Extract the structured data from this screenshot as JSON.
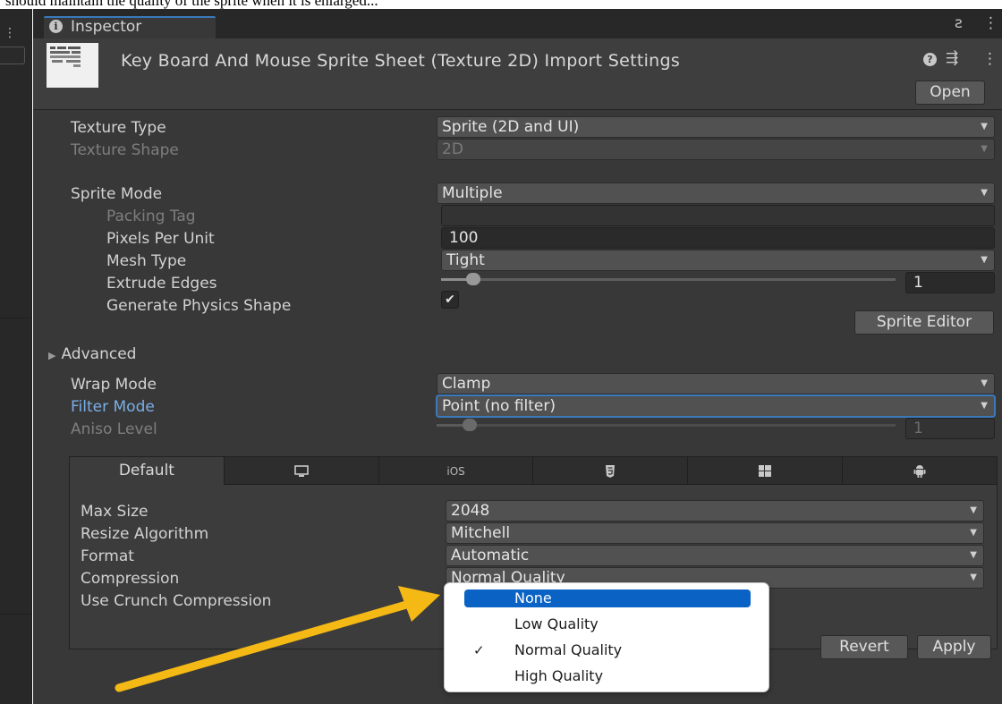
{
  "caption": "should maintain the quality of the sprite when it is enlarged...",
  "window": {
    "tab_label": "Inspector",
    "header_title": "Key Board And Mouse Sprite Sheet (Texture 2D) Import Settings",
    "open_label": "Open"
  },
  "icons": {
    "tab": "info-icon",
    "lock": "lock-icon",
    "menu": "kebab-menu-icon",
    "help": "help-icon",
    "preset": "preset-sliders-icon"
  },
  "fields": {
    "texture_type": {
      "label": "Texture Type",
      "value": "Sprite (2D and UI)"
    },
    "texture_shape": {
      "label": "Texture Shape",
      "value": "2D"
    },
    "sprite_mode": {
      "label": "Sprite Mode",
      "value": "Multiple"
    },
    "packing_tag": {
      "label": "Packing Tag",
      "value": ""
    },
    "pixels_per_unit": {
      "label": "Pixels Per Unit",
      "value": "100"
    },
    "mesh_type": {
      "label": "Mesh Type",
      "value": "Tight"
    },
    "extrude_edges": {
      "label": "Extrude Edges",
      "value": "1",
      "level": 0.06
    },
    "generate_physics_shape": {
      "label": "Generate Physics Shape",
      "checked": true
    },
    "sprite_editor_label": "Sprite Editor",
    "advanced_label": "Advanced",
    "wrap_mode": {
      "label": "Wrap Mode",
      "value": "Clamp"
    },
    "filter_mode": {
      "label": "Filter Mode",
      "value": "Point (no filter)"
    },
    "aniso_level": {
      "label": "Aniso Level",
      "value": "1",
      "level": 0.06
    }
  },
  "platform": {
    "tabs": [
      {
        "label": "Default",
        "icon": null
      },
      {
        "label": "",
        "icon": "monitor-icon"
      },
      {
        "label": "iOS",
        "icon": null
      },
      {
        "label": "",
        "icon": "html5-icon"
      },
      {
        "label": "",
        "icon": "windows-icon"
      },
      {
        "label": "",
        "icon": "android-icon"
      }
    ],
    "max_size": {
      "label": "Max Size",
      "value": "2048"
    },
    "resize_algorithm": {
      "label": "Resize Algorithm",
      "value": "Mitchell"
    },
    "format": {
      "label": "Format",
      "value": "Automatic"
    },
    "compression": {
      "label": "Compression",
      "value": "Normal Quality"
    },
    "use_crunch": {
      "label": "Use Crunch Compression"
    }
  },
  "compression_popup": {
    "options": [
      "None",
      "Low Quality",
      "Normal Quality",
      "High Quality"
    ],
    "highlighted": "None",
    "checked": "Normal Quality"
  },
  "actions": {
    "revert_label": "Revert",
    "apply_label": "Apply"
  },
  "colors": {
    "panel": "#383838",
    "accent_blue": "#3a79bb",
    "annotation_arrow": "#f5b915",
    "popup_highlight": "#0a63c4"
  }
}
